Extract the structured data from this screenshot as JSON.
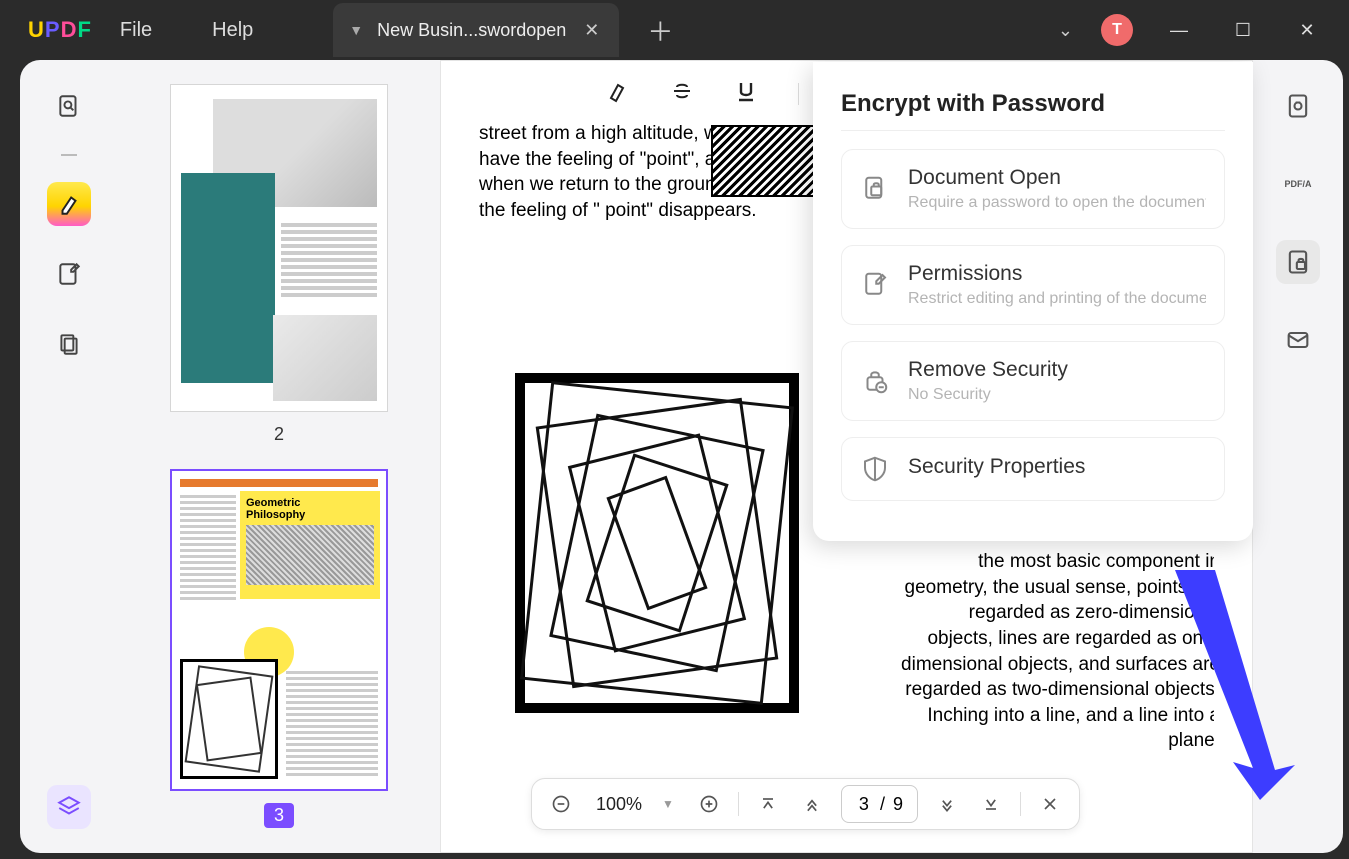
{
  "titlebar": {
    "menu": {
      "file": "File",
      "help": "Help"
    },
    "tab": {
      "title": "New Busin...swordopen"
    },
    "avatar": "T"
  },
  "thumbs": {
    "page2_num": "2",
    "page3_num": "3",
    "page3_title1": "Geometric",
    "page3_title2": "Philosophy"
  },
  "doc": {
    "left_text": "street from a high altitude, we have the feeling of \"point\", and when we return to the ground, the feeling of \" point\" disappears.",
    "right_text": "the most basic component in geometry, the usual sense, points are regarded as zero-dimensional objects, lines are regarded as one-dimensional objects, and surfaces are regarded as two-dimensional objects. Inching into a line, and a line into a plane."
  },
  "zoom": {
    "value": "100%"
  },
  "paging": {
    "current": "3",
    "sep": "/",
    "total": "9"
  },
  "panel": {
    "title": "Encrypt with Password",
    "items": {
      "open": {
        "title": "Document Open",
        "sub": "Require a password to open the document"
      },
      "perm": {
        "title": "Permissions",
        "sub": "Restrict editing and printing of the document"
      },
      "remove": {
        "title": "Remove Security",
        "sub": "No Security"
      },
      "props": {
        "title": "Security Properties"
      }
    }
  },
  "right_rail": {
    "pdfa": "PDF/A"
  }
}
